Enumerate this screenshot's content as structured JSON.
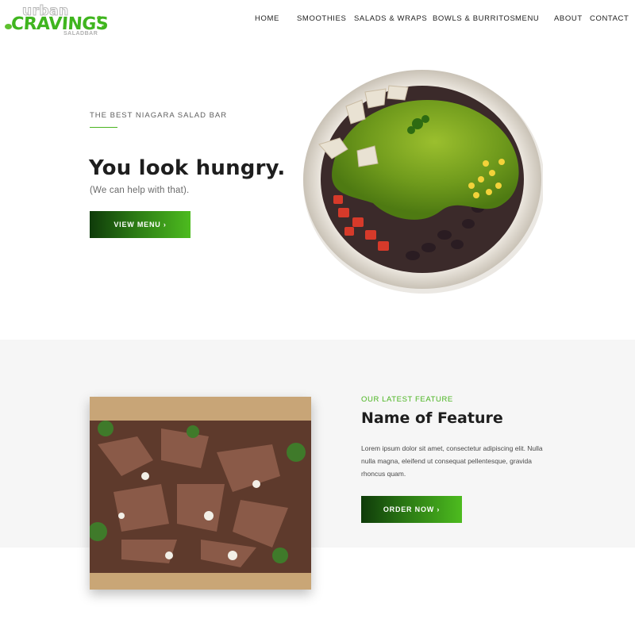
{
  "logo": {
    "line1": "urban",
    "line2": "CRAVINGS",
    "line3": "SALADBAR"
  },
  "nav": {
    "items": [
      {
        "label": "HOME"
      },
      {
        "label": "SMOOTHIES"
      },
      {
        "label": "SALADS & WRAPS"
      },
      {
        "label": "BOWLS & BURRITOS"
      },
      {
        "label": "MENU"
      },
      {
        "label": "ABOUT"
      },
      {
        "label": "CONTACT"
      }
    ]
  },
  "hero": {
    "eyebrow": "THE BEST NIAGARA SALAD BAR",
    "title": "You look hungry.",
    "subtitle": "(We can help with that).",
    "button_label": "VIEW MENU ›"
  },
  "feature": {
    "kicker": "OUR LATEST FEATURE",
    "title": "Name of Feature",
    "body": "Lorem ipsum dolor sit amet, consectetur adipiscing elit. Nulla nulla magna, eleifend ut consequat pellentesque, gravida rhoncus quam.",
    "button_label": "ORDER NOW ›"
  },
  "colors": {
    "brand_green": "#49b41f",
    "button_dark": "#0f3b0a",
    "band_gray": "#f6f6f6"
  }
}
